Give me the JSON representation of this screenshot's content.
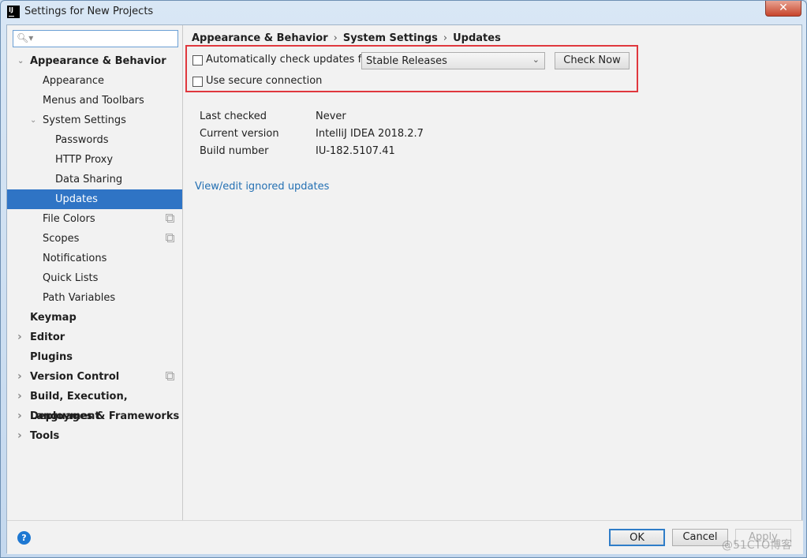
{
  "window": {
    "title": "Settings for New Projects",
    "app_icon_text": "IJ",
    "close_label": "✕"
  },
  "search": {
    "placeholder": "",
    "value": ""
  },
  "sidebar": {
    "items": [
      {
        "label": "Appearance & Behavior",
        "level": 0,
        "expanded": true,
        "bold": true
      },
      {
        "label": "Appearance",
        "level": 1
      },
      {
        "label": "Menus and Toolbars",
        "level": 1
      },
      {
        "label": "System Settings",
        "level": 1,
        "expanded": true
      },
      {
        "label": "Passwords",
        "level": 2
      },
      {
        "label": "HTTP Proxy",
        "level": 2
      },
      {
        "label": "Data Sharing",
        "level": 2
      },
      {
        "label": "Updates",
        "level": 2,
        "selected": true
      },
      {
        "label": "File Colors",
        "level": 1,
        "project_icon": true
      },
      {
        "label": "Scopes",
        "level": 1,
        "project_icon": true
      },
      {
        "label": "Notifications",
        "level": 1
      },
      {
        "label": "Quick Lists",
        "level": 1
      },
      {
        "label": "Path Variables",
        "level": 1
      },
      {
        "label": "Keymap",
        "level": 0,
        "bold": true
      },
      {
        "label": "Editor",
        "level": 0,
        "collapsed": true,
        "bold": true
      },
      {
        "label": "Plugins",
        "level": 0,
        "bold": true
      },
      {
        "label": "Version Control",
        "level": 0,
        "collapsed": true,
        "bold": true,
        "project_icon": true
      },
      {
        "label": "Build, Execution, Deployment",
        "level": 0,
        "collapsed": true,
        "bold": true
      },
      {
        "label": "Languages & Frameworks",
        "level": 0,
        "collapsed": true,
        "bold": true
      },
      {
        "label": "Tools",
        "level": 0,
        "collapsed": true,
        "bold": true
      }
    ]
  },
  "breadcrumb": [
    "Appearance & Behavior",
    "System Settings",
    "Updates"
  ],
  "updates": {
    "auto_check_label": "Automatically check updates for",
    "auto_check": false,
    "channel": "Stable Releases",
    "check_now_label": "Check Now",
    "secure_label": "Use secure connection",
    "secure": false,
    "info": [
      {
        "label": "Last checked",
        "value": "Never"
      },
      {
        "label": "Current version",
        "value": "IntelliJ IDEA 2018.2.7"
      },
      {
        "label": "Build number",
        "value": "IU-182.5107.41"
      }
    ],
    "ignored_link": "View/edit ignored updates"
  },
  "footer": {
    "ok": "OK",
    "cancel": "Cancel",
    "apply": "Apply",
    "help": "?"
  },
  "watermark": "@51CTO博客",
  "colors": {
    "selection": "#2f74c5",
    "highlight_box": "#e0383e",
    "link": "#2470b3"
  }
}
